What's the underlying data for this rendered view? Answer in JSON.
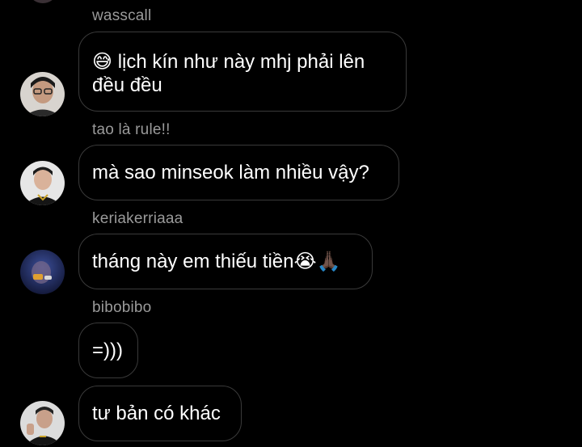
{
  "messages": [
    {
      "sender": "wasscall",
      "text": "😅 lịch kín như này mhj phải lên\nđều đều"
    },
    {
      "sender": "tao là rule!!",
      "text": "mà sao minseok làm nhiều vậy?"
    },
    {
      "sender": "keriakerriaaa",
      "text": "tháng này em thiếu tiền😭🙏🏿"
    },
    {
      "sender": "bibobibo",
      "text": "=)))"
    },
    {
      "sender": "",
      "text": "tư bản có khác"
    }
  ],
  "colors": {
    "background": "#000000",
    "bubble_border": "#3a3a3a",
    "username": "#9a9a9a",
    "message_text": "#ffffff"
  },
  "icons": [
    "user-avatar-icon"
  ]
}
